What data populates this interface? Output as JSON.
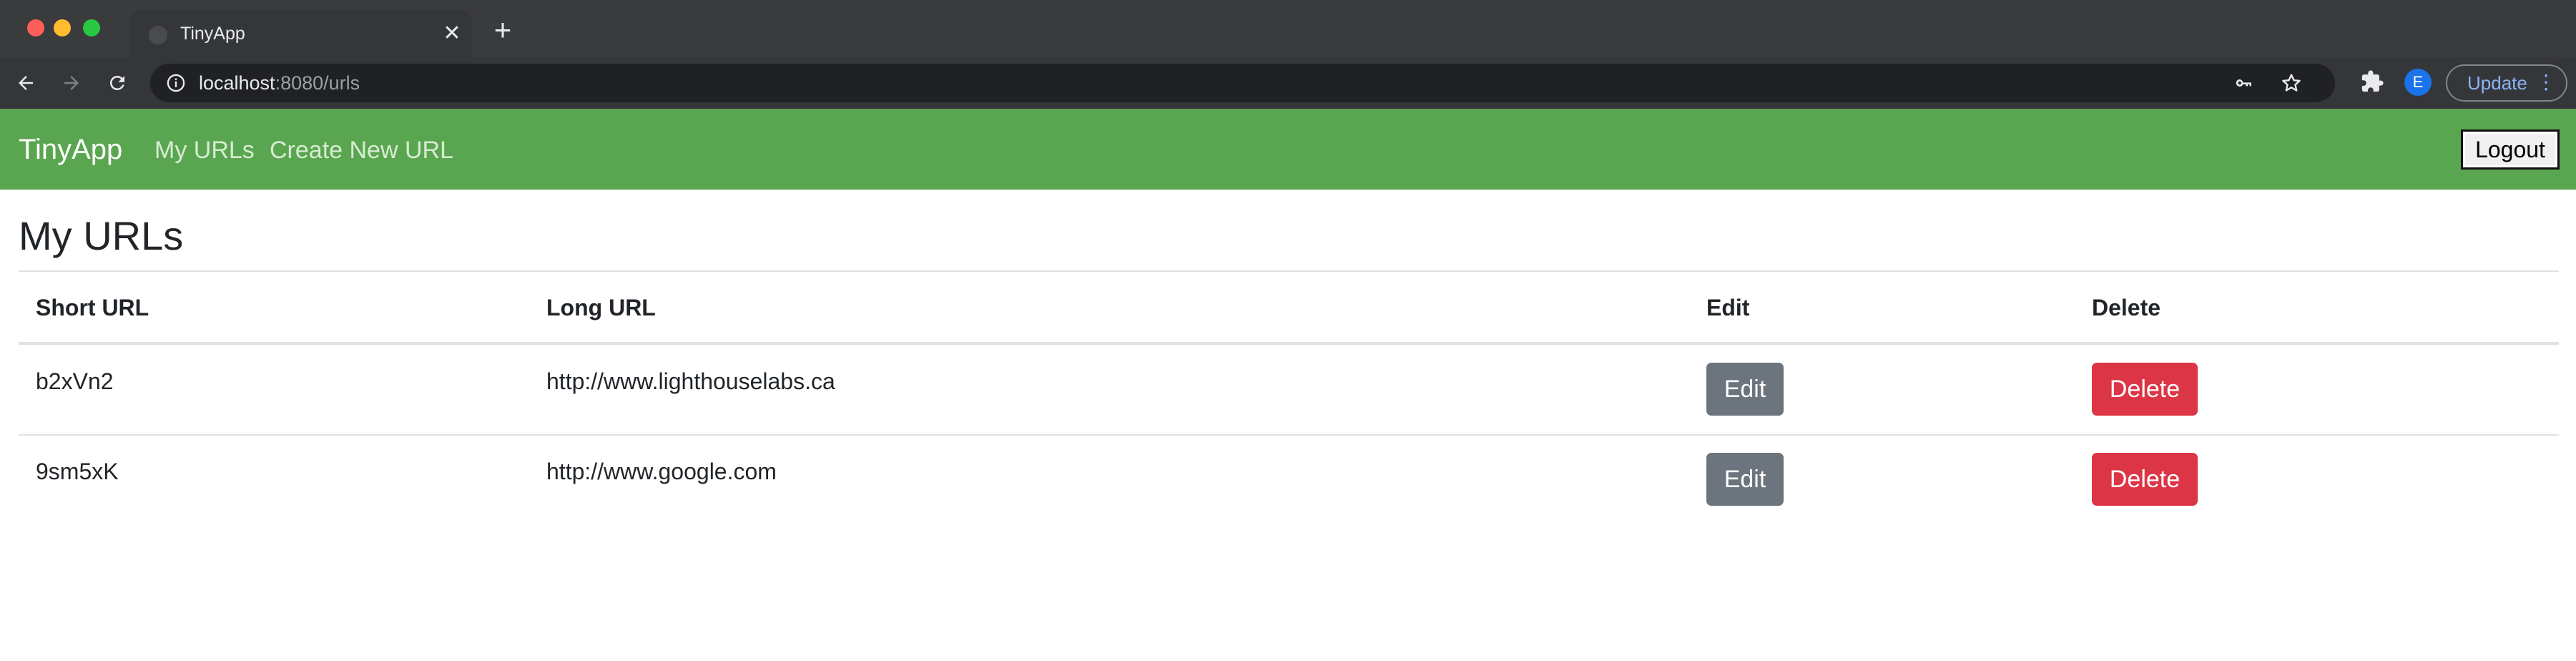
{
  "browser": {
    "tab_title": "TinyApp",
    "tab_close": "✕",
    "new_tab": "+",
    "url_host": "localhost",
    "url_rest": ":8080/urls",
    "profile_initial": "E",
    "update_label": "Update",
    "menu_glyph": "⋮",
    "icons": [
      "back-arrow-icon",
      "forward-arrow-icon",
      "reload-icon",
      "info-icon",
      "key-icon",
      "star-icon",
      "puzzle-extension-icon"
    ]
  },
  "navbar": {
    "brand": "TinyApp",
    "links": [
      "My URLs",
      "Create New URL"
    ],
    "logout_label": "Logout",
    "color": "#5aa650"
  },
  "main": {
    "title": "My URLs",
    "table": {
      "headers": [
        "Short URL",
        "Long URL",
        "Edit",
        "Delete"
      ],
      "rows": [
        {
          "short_url": "b2xVn2",
          "long_url": "http://www.lighthouselabs.ca",
          "edit_label": "Edit",
          "delete_label": "Delete"
        },
        {
          "short_url": "9sm5xK",
          "long_url": "http://www.google.com",
          "edit_label": "Edit",
          "delete_label": "Delete"
        }
      ]
    }
  },
  "colors": {
    "edit_button": "#6c757d",
    "delete_button": "#dc3545"
  }
}
